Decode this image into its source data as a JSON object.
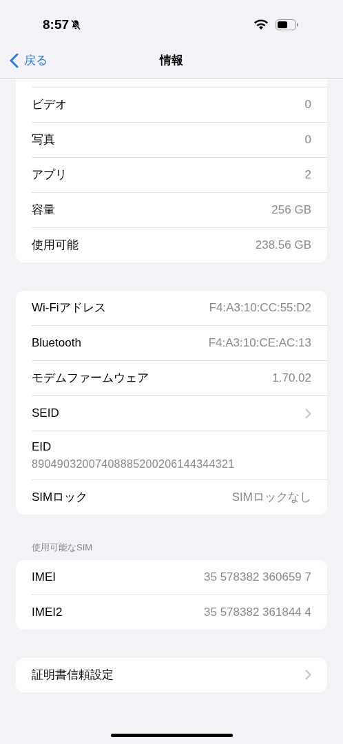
{
  "status_bar": {
    "time": "8:57",
    "silent": true
  },
  "nav": {
    "back": "戻る",
    "title": "情報"
  },
  "groups": [
    {
      "rows": [
        {
          "kind": "value",
          "label": "ビデオ",
          "value": "0"
        },
        {
          "kind": "value",
          "label": "写真",
          "value": "0"
        },
        {
          "kind": "value",
          "label": "アプリ",
          "value": "2"
        },
        {
          "kind": "value",
          "label": "容量",
          "value": "256 GB"
        },
        {
          "kind": "value",
          "label": "使用可能",
          "value": "238.56 GB"
        }
      ]
    },
    {
      "rows": [
        {
          "kind": "value",
          "label": "Wi-Fiアドレス",
          "value": "F4:A3:10:CC:55:D2"
        },
        {
          "kind": "value",
          "label": "Bluetooth",
          "value": "F4:A3:10:CE:AC:13"
        },
        {
          "kind": "value",
          "label": "モデムファームウェア",
          "value": "1.70.02"
        },
        {
          "kind": "chevron",
          "label": "SEID"
        },
        {
          "kind": "stacked",
          "label": "EID",
          "value": "89049032007408885200206144344321"
        },
        {
          "kind": "value",
          "label": "SIMロック",
          "value": "SIMロックなし"
        }
      ]
    },
    {
      "header": "使用可能なSIM",
      "rows": [
        {
          "kind": "value",
          "label": "IMEI",
          "value": "35 578382 360659 7"
        },
        {
          "kind": "value",
          "label": "IMEI2",
          "value": "35 578382 361844 4"
        }
      ]
    },
    {
      "rows": [
        {
          "kind": "chevron",
          "label": "証明書信頼設定"
        }
      ]
    }
  ]
}
